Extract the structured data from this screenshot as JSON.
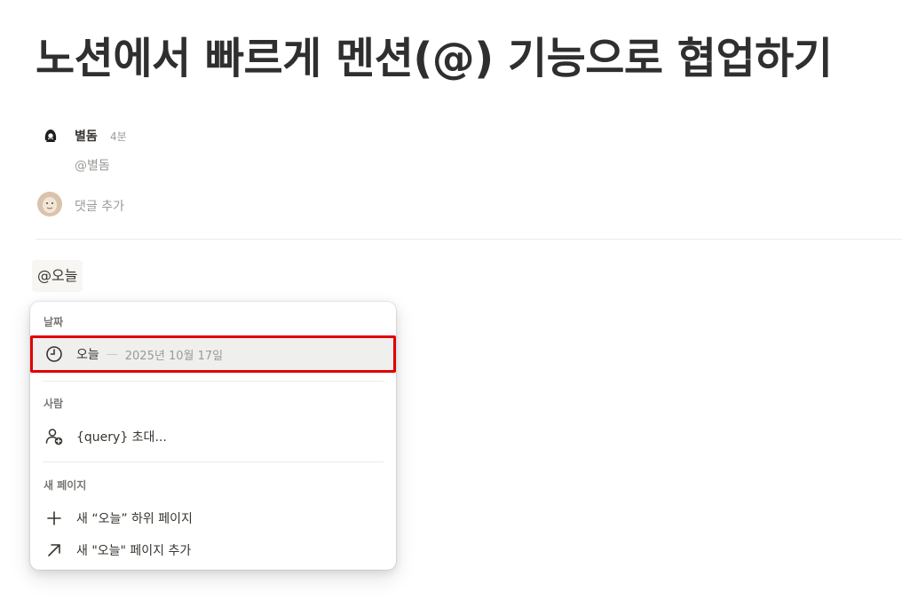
{
  "page": {
    "title": "노션에서 빠르게 멘션(@) 기능으로 협업하기"
  },
  "comment": {
    "author": "별돔",
    "time": "4분",
    "body": "@별돔",
    "add_comment": "댓글 추가"
  },
  "editor": {
    "typed_text": "@오늘"
  },
  "menu": {
    "section_date": "날짜",
    "today_label": "오늘",
    "today_dash": "—",
    "today_date": "2025년 10월 17일",
    "section_people": "사람",
    "invite_label": "{query} 초대...",
    "section_new_page": "새 페이지",
    "new_subpage_label": "새 “오늘” 하위 페이지",
    "add_page_label": "새 \"오늘\" 페이지 추가"
  },
  "colors": {
    "highlight_border": "#e00000",
    "text_primary": "#37352f",
    "text_secondary": "#9b9a97"
  }
}
